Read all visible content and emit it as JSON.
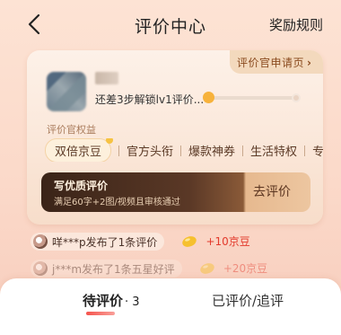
{
  "header": {
    "title": "评价中心",
    "rules_label": "奖励规则"
  },
  "card": {
    "apply_label": "评价官申请页",
    "unlock_text": "还差3步解锁lv1评价...",
    "benefits_title": "评价官权益",
    "benefits": [
      "双倍京豆",
      "官方头衔",
      "爆款神券",
      "生活特权",
      "专属"
    ],
    "review_bar": {
      "title": "写优质评价",
      "subtitle": "满足60字+2图/视频且审核通过",
      "button_label": "去评价"
    }
  },
  "ticker": [
    {
      "text": "咩***p发布了1条评价",
      "reward": "+10京豆"
    },
    {
      "text": "j***m发布了1条五星好评",
      "reward": "+20京豆"
    }
  ],
  "tabs": {
    "pending_label": "待评价",
    "pending_count": "· 3",
    "done_label": "已评价/追评"
  },
  "colors": {
    "accent_red": "#e33a2c",
    "gold": "#f7b23b"
  }
}
